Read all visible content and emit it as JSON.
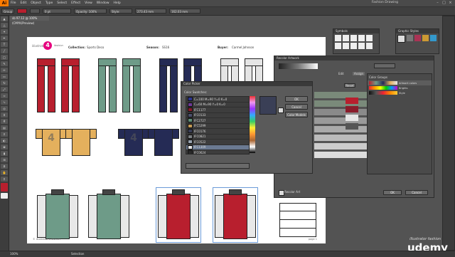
{
  "app": {
    "logo": "Ai",
    "menu": [
      "File",
      "Edit",
      "Object",
      "Type",
      "Select",
      "Effect",
      "View",
      "Window",
      "Help"
    ],
    "workspace": "Fashion Drawing"
  },
  "control_bar": {
    "group_label": "Group",
    "fields": [
      "0 pt",
      "Opacity: 100%",
      "Style:",
      "273.43 mm",
      "162.03 mm"
    ]
  },
  "document_tab": "sb 97.12 @ 100% (CMYK/Preview)",
  "artboard": {
    "brand": "illustrator",
    "brand_suffix": "fashion",
    "logo_number": "4",
    "collection_label": "Collection:",
    "collection_value": "Sports Deco",
    "season_label": "Season:",
    "season_value": "SS16",
    "buyer_label": "Buyer:",
    "buyer_value": "Carmel Johnson",
    "footer_left": "© illustrator 4 fashion",
    "footer_right": "page 1",
    "tee_number": "4"
  },
  "recolor_dialog": {
    "title": "Recolor Artwork",
    "tabs": [
      "Edit",
      "Assign"
    ],
    "reset_label": "Reset",
    "color_groups_label": "Color Groups",
    "group_names": [
      "Artwork colors",
      "Brights",
      "Style"
    ],
    "recolor_art_label": "Recolor Art",
    "ok": "OK",
    "cancel": "Cancel"
  },
  "color_picker": {
    "title": "Color Picker",
    "section": "Color Swatches:",
    "ok": "OK",
    "cancel": "Cancel",
    "color_models": "Color Models",
    "swatches": [
      {
        "name": "C=100 M=90 Y=0 K=0",
        "color": "#2d3591"
      },
      {
        "name": "C=60 M=90 Y=0 K=0",
        "color": "#6e3a98"
      },
      {
        "name": "IFC1177",
        "color": "#8a1c2b"
      },
      {
        "name": "IFC0133",
        "color": "#4b4f6c"
      },
      {
        "name": "IFC2727",
        "color": "#5e8f78"
      },
      {
        "name": "IFC5299",
        "color": "#c59b55"
      },
      {
        "name": "IFC0176",
        "color": "#3a3f56"
      },
      {
        "name": "IFC0821",
        "color": "#7a7e81"
      },
      {
        "name": "IFC0522",
        "color": "#98a3b0"
      },
      {
        "name": "IFC1309",
        "color": "#e4e4e4"
      },
      {
        "name": "IFC0624",
        "color": "#2a2a2a"
      }
    ],
    "selected_index": 9
  },
  "panels": {
    "symbols_title": "Symbols",
    "graphic_styles_title": "Graphic Styles"
  },
  "status": {
    "zoom": "100%",
    "tool": "Selection"
  },
  "watermark": {
    "line1": "illustrator",
    "line2": "fashion",
    "brand": "udemy"
  },
  "colors": {
    "accent": "#ff7c00",
    "logo_pink": "#e6007e",
    "pant_colors": [
      "#b81f2e",
      "#b81f2e",
      "#6e9b88",
      "#6e9b88",
      "#252b55",
      "#252b55",
      "#e5e5e5",
      "#e5e5e5"
    ],
    "tee_colors": [
      "#e4b05d",
      "#e4b05d",
      "#252b55",
      "#252b55"
    ],
    "jacket_colors": [
      "#6e9b88",
      "#6e9b88",
      "#b81f2e",
      "#b81f2e"
    ]
  }
}
